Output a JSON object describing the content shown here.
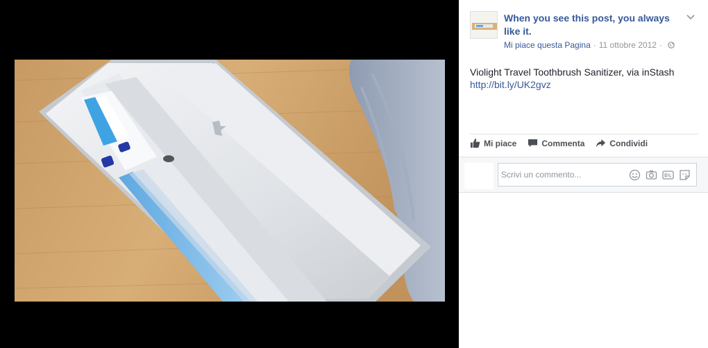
{
  "post": {
    "page_name": "When you see this post, you always like it.",
    "like_page": "Mi piace questa Pagina",
    "separator": "·",
    "date": "11 ottobre 2012",
    "separator2": "·",
    "text": "Violight Travel Toothbrush Sanitizer, via inStash",
    "link": "http://bit.ly/UK2gvz"
  },
  "actions": {
    "like": "Mi piace",
    "comment": "Commenta",
    "share": "Condividi"
  },
  "comment": {
    "placeholder": "Scrivi un commento..."
  },
  "icons": [
    "chevron-down-icon",
    "globe-icon",
    "thumbs-up-icon",
    "speech-bubble-icon",
    "share-arrow-icon",
    "emoji-icon",
    "camera-icon",
    "gif-icon",
    "sticker-icon"
  ],
  "colors": {
    "link": "#365899",
    "meta": "#90949c",
    "text": "#1d2129",
    "background": "#000000"
  }
}
